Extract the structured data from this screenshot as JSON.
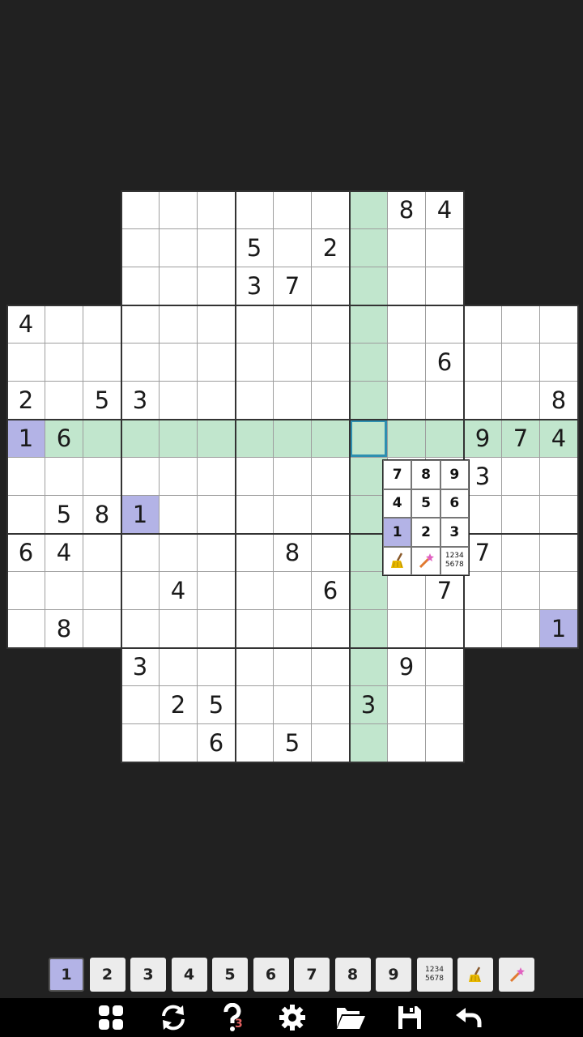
{
  "grid": {
    "cells": [
      {
        "r": 0,
        "c": 3,
        "v": ""
      },
      {
        "r": 0,
        "c": 4,
        "v": ""
      },
      {
        "r": 0,
        "c": 5,
        "v": ""
      },
      {
        "r": 0,
        "c": 6,
        "v": ""
      },
      {
        "r": 0,
        "c": 7,
        "v": ""
      },
      {
        "r": 0,
        "c": 8,
        "v": ""
      },
      {
        "r": 0,
        "c": 9,
        "v": ""
      },
      {
        "r": 0,
        "c": 10,
        "v": "8"
      },
      {
        "r": 0,
        "c": 11,
        "v": "4"
      },
      {
        "r": 1,
        "c": 3,
        "v": ""
      },
      {
        "r": 1,
        "c": 4,
        "v": ""
      },
      {
        "r": 1,
        "c": 5,
        "v": ""
      },
      {
        "r": 1,
        "c": 6,
        "v": "5"
      },
      {
        "r": 1,
        "c": 7,
        "v": ""
      },
      {
        "r": 1,
        "c": 8,
        "v": "2"
      },
      {
        "r": 1,
        "c": 9,
        "v": ""
      },
      {
        "r": 1,
        "c": 10,
        "v": ""
      },
      {
        "r": 1,
        "c": 11,
        "v": ""
      },
      {
        "r": 2,
        "c": 3,
        "v": ""
      },
      {
        "r": 2,
        "c": 4,
        "v": ""
      },
      {
        "r": 2,
        "c": 5,
        "v": ""
      },
      {
        "r": 2,
        "c": 6,
        "v": "3"
      },
      {
        "r": 2,
        "c": 7,
        "v": "7"
      },
      {
        "r": 2,
        "c": 8,
        "v": ""
      },
      {
        "r": 2,
        "c": 9,
        "v": ""
      },
      {
        "r": 2,
        "c": 10,
        "v": ""
      },
      {
        "r": 2,
        "c": 11,
        "v": ""
      },
      {
        "r": 3,
        "c": 0,
        "v": "4"
      },
      {
        "r": 3,
        "c": 1,
        "v": ""
      },
      {
        "r": 3,
        "c": 2,
        "v": ""
      },
      {
        "r": 3,
        "c": 3,
        "v": ""
      },
      {
        "r": 3,
        "c": 4,
        "v": ""
      },
      {
        "r": 3,
        "c": 5,
        "v": ""
      },
      {
        "r": 3,
        "c": 6,
        "v": ""
      },
      {
        "r": 3,
        "c": 7,
        "v": ""
      },
      {
        "r": 3,
        "c": 8,
        "v": ""
      },
      {
        "r": 3,
        "c": 9,
        "v": ""
      },
      {
        "r": 3,
        "c": 10,
        "v": ""
      },
      {
        "r": 3,
        "c": 11,
        "v": ""
      },
      {
        "r": 3,
        "c": 12,
        "v": ""
      },
      {
        "r": 3,
        "c": 13,
        "v": ""
      },
      {
        "r": 3,
        "c": 14,
        "v": ""
      },
      {
        "r": 4,
        "c": 0,
        "v": ""
      },
      {
        "r": 4,
        "c": 1,
        "v": ""
      },
      {
        "r": 4,
        "c": 2,
        "v": ""
      },
      {
        "r": 4,
        "c": 3,
        "v": ""
      },
      {
        "r": 4,
        "c": 4,
        "v": ""
      },
      {
        "r": 4,
        "c": 5,
        "v": ""
      },
      {
        "r": 4,
        "c": 6,
        "v": ""
      },
      {
        "r": 4,
        "c": 7,
        "v": ""
      },
      {
        "r": 4,
        "c": 8,
        "v": ""
      },
      {
        "r": 4,
        "c": 9,
        "v": ""
      },
      {
        "r": 4,
        "c": 10,
        "v": ""
      },
      {
        "r": 4,
        "c": 11,
        "v": "6"
      },
      {
        "r": 4,
        "c": 12,
        "v": ""
      },
      {
        "r": 4,
        "c": 13,
        "v": ""
      },
      {
        "r": 4,
        "c": 14,
        "v": ""
      },
      {
        "r": 5,
        "c": 0,
        "v": "2"
      },
      {
        "r": 5,
        "c": 1,
        "v": ""
      },
      {
        "r": 5,
        "c": 2,
        "v": "5"
      },
      {
        "r": 5,
        "c": 3,
        "v": "3"
      },
      {
        "r": 5,
        "c": 4,
        "v": ""
      },
      {
        "r": 5,
        "c": 5,
        "v": ""
      },
      {
        "r": 5,
        "c": 6,
        "v": ""
      },
      {
        "r": 5,
        "c": 7,
        "v": ""
      },
      {
        "r": 5,
        "c": 8,
        "v": ""
      },
      {
        "r": 5,
        "c": 9,
        "v": ""
      },
      {
        "r": 5,
        "c": 10,
        "v": ""
      },
      {
        "r": 5,
        "c": 11,
        "v": ""
      },
      {
        "r": 5,
        "c": 12,
        "v": ""
      },
      {
        "r": 5,
        "c": 13,
        "v": ""
      },
      {
        "r": 5,
        "c": 14,
        "v": "8"
      },
      {
        "r": 6,
        "c": 0,
        "v": "1"
      },
      {
        "r": 6,
        "c": 1,
        "v": "6"
      },
      {
        "r": 6,
        "c": 2,
        "v": ""
      },
      {
        "r": 6,
        "c": 3,
        "v": ""
      },
      {
        "r": 6,
        "c": 4,
        "v": ""
      },
      {
        "r": 6,
        "c": 5,
        "v": ""
      },
      {
        "r": 6,
        "c": 6,
        "v": ""
      },
      {
        "r": 6,
        "c": 7,
        "v": ""
      },
      {
        "r": 6,
        "c": 8,
        "v": ""
      },
      {
        "r": 6,
        "c": 9,
        "v": ""
      },
      {
        "r": 6,
        "c": 10,
        "v": ""
      },
      {
        "r": 6,
        "c": 11,
        "v": ""
      },
      {
        "r": 6,
        "c": 12,
        "v": "9"
      },
      {
        "r": 6,
        "c": 13,
        "v": "7"
      },
      {
        "r": 6,
        "c": 14,
        "v": "4"
      },
      {
        "r": 7,
        "c": 0,
        "v": ""
      },
      {
        "r": 7,
        "c": 1,
        "v": ""
      },
      {
        "r": 7,
        "c": 2,
        "v": ""
      },
      {
        "r": 7,
        "c": 3,
        "v": ""
      },
      {
        "r": 7,
        "c": 4,
        "v": ""
      },
      {
        "r": 7,
        "c": 5,
        "v": ""
      },
      {
        "r": 7,
        "c": 6,
        "v": ""
      },
      {
        "r": 7,
        "c": 7,
        "v": ""
      },
      {
        "r": 7,
        "c": 8,
        "v": ""
      },
      {
        "r": 7,
        "c": 9,
        "v": ""
      },
      {
        "r": 7,
        "c": 10,
        "v": ""
      },
      {
        "r": 7,
        "c": 11,
        "v": ""
      },
      {
        "r": 7,
        "c": 12,
        "v": "3"
      },
      {
        "r": 7,
        "c": 13,
        "v": ""
      },
      {
        "r": 7,
        "c": 14,
        "v": ""
      },
      {
        "r": 8,
        "c": 0,
        "v": ""
      },
      {
        "r": 8,
        "c": 1,
        "v": "5"
      },
      {
        "r": 8,
        "c": 2,
        "v": "8"
      },
      {
        "r": 8,
        "c": 3,
        "v": "1"
      },
      {
        "r": 8,
        "c": 4,
        "v": ""
      },
      {
        "r": 8,
        "c": 5,
        "v": ""
      },
      {
        "r": 8,
        "c": 6,
        "v": ""
      },
      {
        "r": 8,
        "c": 7,
        "v": ""
      },
      {
        "r": 8,
        "c": 8,
        "v": ""
      },
      {
        "r": 8,
        "c": 9,
        "v": ""
      },
      {
        "r": 8,
        "c": 10,
        "v": ""
      },
      {
        "r": 8,
        "c": 11,
        "v": ""
      },
      {
        "r": 8,
        "c": 12,
        "v": ""
      },
      {
        "r": 8,
        "c": 13,
        "v": ""
      },
      {
        "r": 8,
        "c": 14,
        "v": ""
      },
      {
        "r": 9,
        "c": 0,
        "v": "6"
      },
      {
        "r": 9,
        "c": 1,
        "v": "4"
      },
      {
        "r": 9,
        "c": 2,
        "v": ""
      },
      {
        "r": 9,
        "c": 3,
        "v": ""
      },
      {
        "r": 9,
        "c": 4,
        "v": ""
      },
      {
        "r": 9,
        "c": 5,
        "v": ""
      },
      {
        "r": 9,
        "c": 6,
        "v": ""
      },
      {
        "r": 9,
        "c": 7,
        "v": "8"
      },
      {
        "r": 9,
        "c": 8,
        "v": ""
      },
      {
        "r": 9,
        "c": 9,
        "v": ""
      },
      {
        "r": 9,
        "c": 10,
        "v": ""
      },
      {
        "r": 9,
        "c": 11,
        "v": ""
      },
      {
        "r": 9,
        "c": 12,
        "v": "7"
      },
      {
        "r": 9,
        "c": 13,
        "v": ""
      },
      {
        "r": 9,
        "c": 14,
        "v": ""
      },
      {
        "r": 10,
        "c": 0,
        "v": ""
      },
      {
        "r": 10,
        "c": 1,
        "v": ""
      },
      {
        "r": 10,
        "c": 2,
        "v": ""
      },
      {
        "r": 10,
        "c": 3,
        "v": ""
      },
      {
        "r": 10,
        "c": 4,
        "v": "4"
      },
      {
        "r": 10,
        "c": 5,
        "v": ""
      },
      {
        "r": 10,
        "c": 6,
        "v": ""
      },
      {
        "r": 10,
        "c": 7,
        "v": ""
      },
      {
        "r": 10,
        "c": 8,
        "v": "6"
      },
      {
        "r": 10,
        "c": 9,
        "v": ""
      },
      {
        "r": 10,
        "c": 10,
        "v": ""
      },
      {
        "r": 10,
        "c": 11,
        "v": "7"
      },
      {
        "r": 10,
        "c": 12,
        "v": ""
      },
      {
        "r": 10,
        "c": 13,
        "v": ""
      },
      {
        "r": 10,
        "c": 14,
        "v": ""
      },
      {
        "r": 11,
        "c": 0,
        "v": ""
      },
      {
        "r": 11,
        "c": 1,
        "v": "8"
      },
      {
        "r": 11,
        "c": 2,
        "v": ""
      },
      {
        "r": 11,
        "c": 3,
        "v": ""
      },
      {
        "r": 11,
        "c": 4,
        "v": ""
      },
      {
        "r": 11,
        "c": 5,
        "v": ""
      },
      {
        "r": 11,
        "c": 6,
        "v": ""
      },
      {
        "r": 11,
        "c": 7,
        "v": ""
      },
      {
        "r": 11,
        "c": 8,
        "v": ""
      },
      {
        "r": 11,
        "c": 9,
        "v": ""
      },
      {
        "r": 11,
        "c": 10,
        "v": ""
      },
      {
        "r": 11,
        "c": 11,
        "v": ""
      },
      {
        "r": 11,
        "c": 12,
        "v": ""
      },
      {
        "r": 11,
        "c": 13,
        "v": ""
      },
      {
        "r": 11,
        "c": 14,
        "v": "1"
      },
      {
        "r": 12,
        "c": 3,
        "v": "3"
      },
      {
        "r": 12,
        "c": 4,
        "v": ""
      },
      {
        "r": 12,
        "c": 5,
        "v": ""
      },
      {
        "r": 12,
        "c": 6,
        "v": ""
      },
      {
        "r": 12,
        "c": 7,
        "v": ""
      },
      {
        "r": 12,
        "c": 8,
        "v": ""
      },
      {
        "r": 12,
        "c": 9,
        "v": ""
      },
      {
        "r": 12,
        "c": 10,
        "v": "9"
      },
      {
        "r": 12,
        "c": 11,
        "v": ""
      },
      {
        "r": 13,
        "c": 3,
        "v": ""
      },
      {
        "r": 13,
        "c": 4,
        "v": "2"
      },
      {
        "r": 13,
        "c": 5,
        "v": "5"
      },
      {
        "r": 13,
        "c": 6,
        "v": ""
      },
      {
        "r": 13,
        "c": 7,
        "v": ""
      },
      {
        "r": 13,
        "c": 8,
        "v": ""
      },
      {
        "r": 13,
        "c": 9,
        "v": "3"
      },
      {
        "r": 13,
        "c": 10,
        "v": ""
      },
      {
        "r": 13,
        "c": 11,
        "v": ""
      },
      {
        "r": 14,
        "c": 3,
        "v": ""
      },
      {
        "r": 14,
        "c": 4,
        "v": ""
      },
      {
        "r": 14,
        "c": 5,
        "v": "6"
      },
      {
        "r": 14,
        "c": 6,
        "v": ""
      },
      {
        "r": 14,
        "c": 7,
        "v": "5"
      },
      {
        "r": 14,
        "c": 8,
        "v": ""
      },
      {
        "r": 14,
        "c": 9,
        "v": ""
      },
      {
        "r": 14,
        "c": 10,
        "v": ""
      },
      {
        "r": 14,
        "c": 11,
        "v": ""
      }
    ],
    "selected": {
      "r": 6,
      "c": 9
    },
    "highlight_digit": "1"
  },
  "popup": {
    "keys": [
      "7",
      "8",
      "9",
      "4",
      "5",
      "6",
      "1",
      "2",
      "3"
    ],
    "active": "1",
    "eraser_icon": "broom-icon",
    "hint_icon": "magic-wand-icon",
    "notes_label": "1234\n5678"
  },
  "numbar": {
    "digits": [
      "1",
      "2",
      "3",
      "4",
      "5",
      "6",
      "7",
      "8",
      "9"
    ],
    "active": "1",
    "notes_label": "1234\n5678",
    "eraser_icon": "broom-icon",
    "hint_icon": "magic-wand-icon"
  },
  "toolbar": {
    "items": [
      "grid-menu-icon",
      "refresh-icon",
      "help-icon",
      "settings-gear-icon",
      "open-folder-icon",
      "save-icon",
      "undo-icon"
    ],
    "hint_count": "3"
  },
  "colors": {
    "background": "#212121",
    "highlight_green": "#c1e6cd",
    "same_digit_purple": "#b3b3e6",
    "selection_blue": "#2e8fb0"
  }
}
